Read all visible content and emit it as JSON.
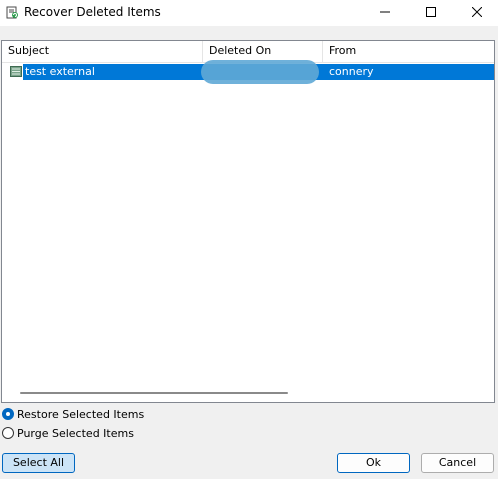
{
  "window": {
    "title": "Recover Deleted Items",
    "icon": "recover-items-icon",
    "controls": [
      "minimize-icon",
      "maximize-icon",
      "close-icon"
    ]
  },
  "list": {
    "columns": [
      "Subject",
      "Deleted On",
      "From"
    ],
    "rows": [
      {
        "icon": "message-icon",
        "subject": "test external",
        "deleted_on": "",
        "from": "connery",
        "selected": true
      }
    ]
  },
  "options": {
    "restore_label": "Restore Selected Items",
    "purge_label": "Purge Selected Items",
    "selected": "restore"
  },
  "buttons": {
    "select_all": "Select All",
    "ok": "Ok",
    "cancel": "Cancel"
  },
  "colors": {
    "selection": "#0078d7",
    "accent": "#0067c0"
  }
}
